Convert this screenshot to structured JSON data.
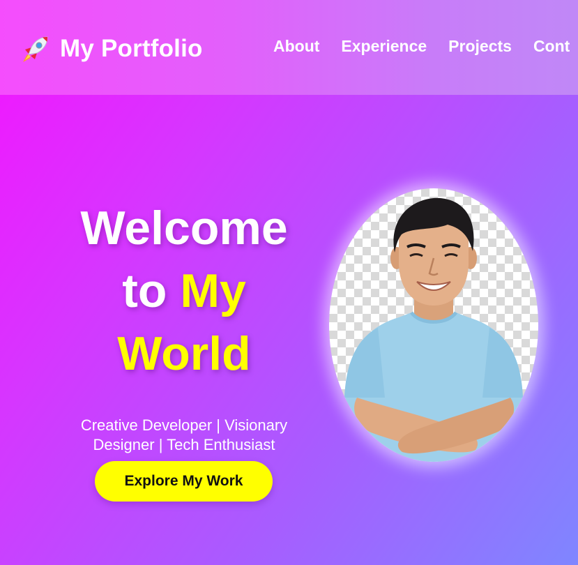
{
  "header": {
    "brand_icon": "rocket-icon",
    "brand": "My Portfolio",
    "nav": [
      {
        "label": "About"
      },
      {
        "label": "Experience"
      },
      {
        "label": "Projects"
      },
      {
        "label": "Cont"
      }
    ]
  },
  "hero": {
    "title_line1": "Welcome",
    "title_line2_white": "to",
    "title_line2_yellow": "My",
    "title_line3": "World",
    "tagline_line1": "Creative Developer | Visionary",
    "tagline_line2": "Designer | Tech Enthusiast",
    "cta_label": "Explore My Work"
  },
  "colors": {
    "accent": "#ffff00",
    "gradient_start": "#f414ff",
    "gradient_end": "#7f86ff",
    "text": "#ffffff"
  }
}
